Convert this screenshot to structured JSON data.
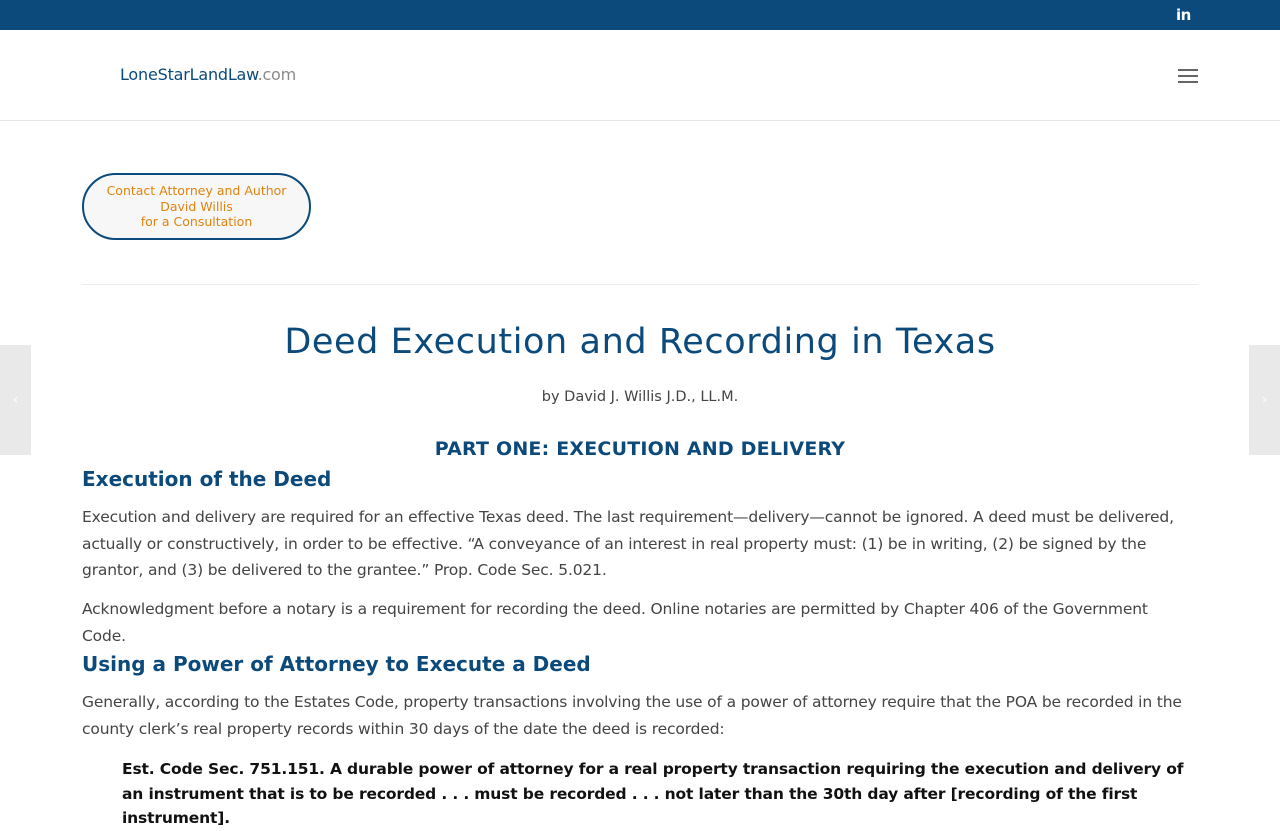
{
  "topbar": {
    "linkedin_icon": "linkedin-icon",
    "linkedin_text": "in"
  },
  "header": {
    "logo_main": "LoneStarLandLaw",
    "logo_tld": ".com",
    "menu_icon": "hamburger-menu-icon"
  },
  "cta": {
    "line1": "Contact Attorney and Author",
    "line2": "David Willis",
    "line3": "for a Consultation"
  },
  "nav": {
    "prev": "‹",
    "next": "›"
  },
  "article": {
    "title": "Deed Execution and Recording in Texas",
    "byline": "by David J. Willis J.D., LL.M.",
    "part": "PART ONE: EXECUTION AND DELIVERY",
    "section1_heading": "Execution of the Deed",
    "section1_p1": "Execution and delivery are required for an effective Texas deed. The last requirement—delivery—cannot be ignored. A deed must be delivered, actually or constructively, in order to be effective. “A conveyance of an interest in real property must: (1) be in writing, (2) be signed by the grantor, and (3) be delivered to the grantee.” Prop. Code Sec. 5.021.",
    "section1_p2": "Acknowledgment before a notary is a requirement for recording the deed. Online notaries are permitted by Chapter 406 of the Government Code.",
    "section2_heading": "Using a Power of Attorney to Execute a Deed",
    "section2_p1": "Generally, according to the Estates Code, property transactions involving the use of a power of attorney require that the POA be recorded in the county clerk’s real property records within 30 days of the date the deed is recorded:",
    "quote": "Est. Code Sec. 751.151. A durable power of attorney for a real property transaction requiring the execution and delivery of an instrument that is to be recorded . . . must be recorded . . . not later than the 30th day after [recording of the first instrument]."
  }
}
